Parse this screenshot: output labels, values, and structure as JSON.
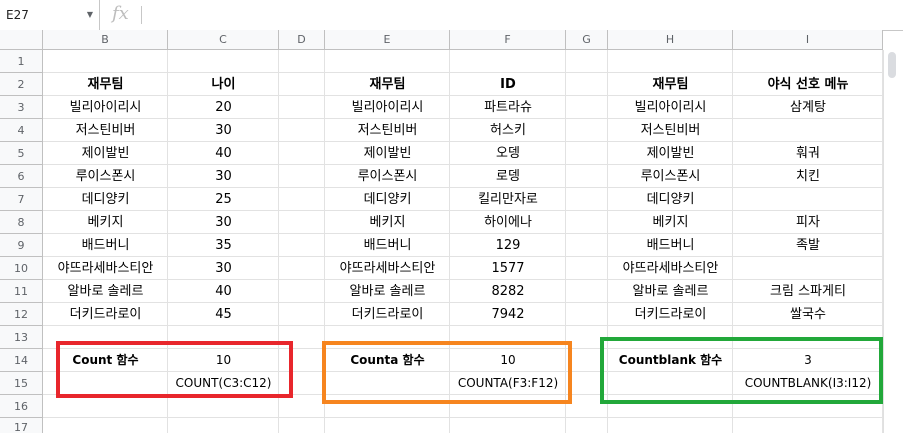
{
  "name_box": "E27",
  "fx_symbol": "fx",
  "columns": [
    "B",
    "C",
    "D",
    "E",
    "F",
    "G",
    "H",
    "I"
  ],
  "rows": [
    "1",
    "2",
    "3",
    "4",
    "5",
    "6",
    "7",
    "8",
    "9",
    "10",
    "11",
    "12",
    "13",
    "14",
    "15",
    "16",
    "17"
  ],
  "headers": {
    "b": "재무팀",
    "c": "나이",
    "e": "재무팀",
    "f": "ID",
    "h": "재무팀",
    "i": "야식 선호 메뉴"
  },
  "names": [
    "빌리아이리시",
    "저스틴비버",
    "제이발빈",
    "루이스폰시",
    "데디양키",
    "베키지",
    "배드버니",
    "야뜨라세바스티안",
    "알바로 솔레르",
    "더키드라로이"
  ],
  "ages": [
    "20",
    "30",
    "40",
    "30",
    "25",
    "30",
    "35",
    "30",
    "40",
    "45"
  ],
  "ids": [
    "파트라슈",
    "허스키",
    "오뎅",
    "로뎅",
    "킬리만자로",
    "하이에나",
    "129",
    "1577",
    "8282",
    "7942"
  ],
  "menus": [
    "삼계탕",
    "",
    "훠궈",
    "치킨",
    "",
    "피자",
    "족발",
    "",
    "크림 스파게티",
    "쌀국수"
  ],
  "summary": {
    "count_label": "Count 함수",
    "count_value": "10",
    "count_formula": "COUNT(C3:C12)",
    "counta_label": "Counta 함수",
    "counta_value": "10",
    "counta_formula": "COUNTA(F3:F12)",
    "countblank_label": "Countblank 함수",
    "countblank_value": "3",
    "countblank_formula": "COUNTBLANK(I3:I12)"
  },
  "colors": {
    "red_frame": "#e8262c",
    "orange_frame": "#f6851f",
    "green_frame": "#22a83a"
  }
}
